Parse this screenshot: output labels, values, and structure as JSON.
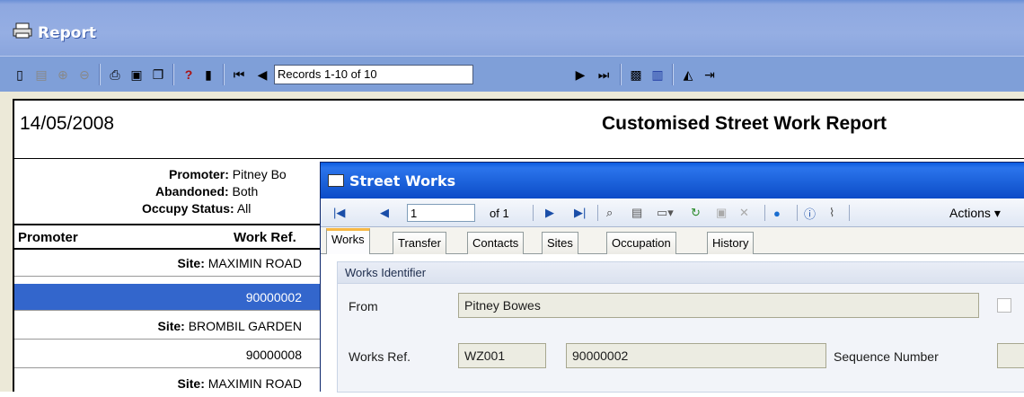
{
  "report": {
    "title": "Report",
    "records_text": "Records 1-10 of 10",
    "date": "14/05/2008",
    "heading": "Customised Street Work Report",
    "filters": {
      "promoter_label": "Promoter:",
      "promoter_value": "Pitney Bo",
      "abandoned_label": "Abandoned:",
      "abandoned_value": "Both",
      "occupy_label": "Occupy Status:",
      "occupy_value": "All"
    },
    "columns": {
      "promoter": "Promoter",
      "work_ref": "Work Ref."
    },
    "rows": [
      {
        "label": "Site:",
        "value": "MAXIMIN ROAD",
        "type": "site"
      },
      {
        "value": "90000002",
        "type": "ref",
        "selected": true
      },
      {
        "label": "Site:",
        "value": "BROMBIL GARDEN",
        "type": "site"
      },
      {
        "value": "90000008",
        "type": "ref"
      },
      {
        "label": "Site:",
        "value": "MAXIMIN ROAD",
        "type": "site"
      }
    ]
  },
  "street_works": {
    "title": "Street Works",
    "page_value": "1",
    "page_of": "of 1",
    "actions_label": "Actions",
    "tabs": [
      "Works",
      "Transfer",
      "Contacts",
      "Sites",
      "Occupation",
      "History"
    ],
    "group_title": "Works Identifier",
    "from_label": "From",
    "from_value": "Pitney Bowes",
    "works_ref_label": "Works Ref.",
    "works_ref_prefix": "WZ001",
    "works_ref_number": "90000002",
    "sequence_label": "Sequence Number"
  },
  "colors": {
    "titlebar": "#95aee3",
    "toolbar": "#7f9fd8",
    "selection": "#3366cc",
    "dialog_titlebar": "#1a5fd8",
    "active_tab_accent": "#f6b846"
  }
}
